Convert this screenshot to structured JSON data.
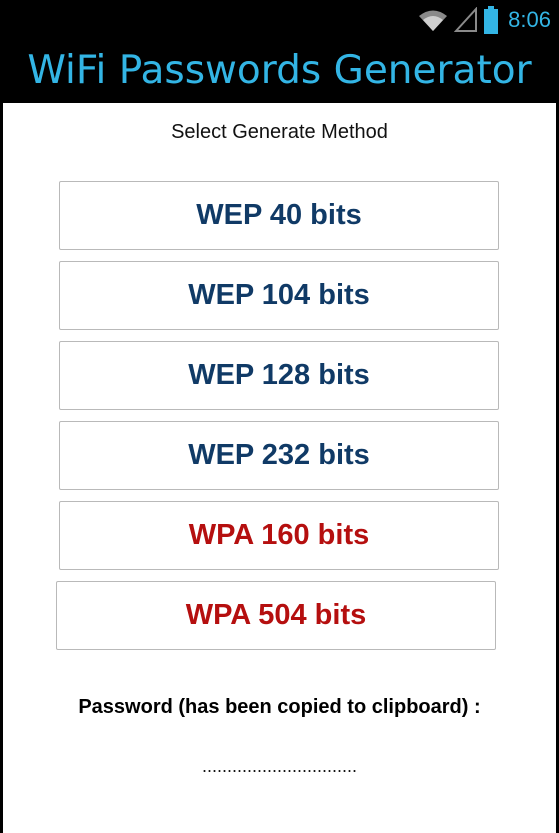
{
  "status_bar": {
    "time": "8:06",
    "icons": [
      "wifi-icon",
      "cell-signal-icon",
      "battery-icon"
    ]
  },
  "app": {
    "title": "WiFi Passwords Generator"
  },
  "main": {
    "subtitle": "Select Generate Method",
    "buttons": [
      {
        "label": "WEP 40 bits",
        "kind": "wep"
      },
      {
        "label": "WEP 104 bits",
        "kind": "wep"
      },
      {
        "label": "WEP 128 bits",
        "kind": "wep"
      },
      {
        "label": "WEP 232 bits",
        "kind": "wep"
      },
      {
        "label": "WPA 160 bits",
        "kind": "wpa"
      },
      {
        "label": "WPA 504 bits",
        "kind": "wpa"
      }
    ],
    "password_label": "Password (has been copied to clipboard) :",
    "password_value": "..............................."
  },
  "colors": {
    "accent": "#33b5e5",
    "wep_text": "#103a66",
    "wpa_text": "#b50f0f",
    "background": "#ffffff",
    "bar_background": "#000000"
  }
}
